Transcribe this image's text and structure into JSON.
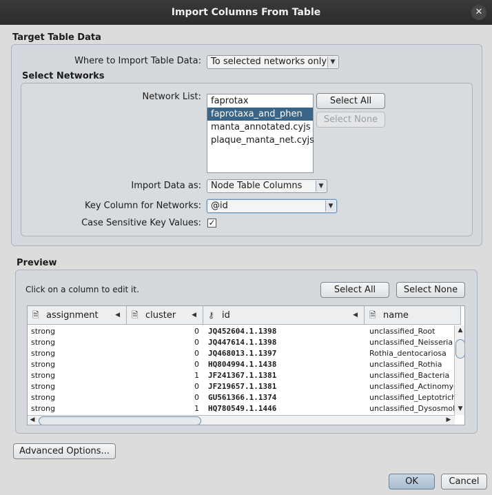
{
  "window": {
    "title": "Import Columns From Table",
    "close_glyph": "✕"
  },
  "target": {
    "section_title": "Target Table Data",
    "where_label": "Where to Import Table Data:",
    "where_value": "To selected networks only"
  },
  "networks": {
    "section_title": "Select Networks",
    "list_label": "Network List:",
    "items": [
      "faprotax",
      "faprotaxa_and_phen",
      "manta_annotated.cyjs",
      "plaque_manta_net.cyjs"
    ],
    "selected_index": 1,
    "select_all": "Select All",
    "select_none": "Select None",
    "import_as_label": "Import Data as:",
    "import_as_value": "Node Table Columns",
    "key_col_label": "Key Column for Networks:",
    "key_col_value": "@id",
    "case_label": "Case Sensitive Key Values:",
    "case_checked": "✓"
  },
  "preview": {
    "section_title": "Preview",
    "hint": "Click on a column to edit it.",
    "select_all": "Select All",
    "select_none": "Select None",
    "columns": [
      {
        "name": "assignment",
        "icon": "document-icon",
        "glyph": "🗎"
      },
      {
        "name": "cluster",
        "icon": "document-icon",
        "glyph": "🗎"
      },
      {
        "name": "id",
        "icon": "key-icon",
        "glyph": "⚷"
      },
      {
        "name": "name",
        "icon": "document-icon",
        "glyph": "🗎"
      }
    ],
    "rows": [
      [
        "strong",
        "0",
        "JQ452604.1.1398",
        "unclassified_Root"
      ],
      [
        "strong",
        "0",
        "JQ447614.1.1398",
        "unclassified_Neisseria"
      ],
      [
        "strong",
        "0",
        "JQ468013.1.1397",
        "Rothia_dentocariosa"
      ],
      [
        "strong",
        "0",
        "HQ804994.1.1438",
        "unclassified_Rothia"
      ],
      [
        "strong",
        "1",
        "JF241367.1.1381",
        "unclassified_Bacteria"
      ],
      [
        "strong",
        "0",
        "JF219657.1.1381",
        "unclassified_Actinomyces"
      ],
      [
        "strong",
        "0",
        "GU561366.1.1374",
        "unclassified_Leptotrichia"
      ],
      [
        "strong",
        "1",
        "HQ780549.1.1446",
        "unclassified_Dysosmobacter"
      ]
    ]
  },
  "footer": {
    "advanced": "Advanced Options...",
    "ok": "OK",
    "cancel": "Cancel"
  }
}
